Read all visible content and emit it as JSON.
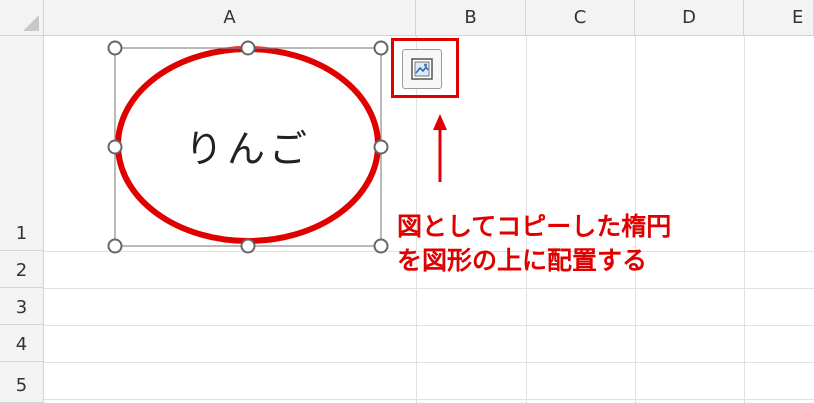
{
  "spreadsheet": {
    "columns": [
      "A",
      "B",
      "C",
      "D",
      "E"
    ],
    "rows": [
      "1",
      "2",
      "3",
      "4",
      "5"
    ]
  },
  "shape": {
    "text": "りんご",
    "outline_color": "#e00000",
    "selection_handle_icon": "resize-handle-icon"
  },
  "paste_options": {
    "icon": "paste-options-icon",
    "highlight_color": "#e00000"
  },
  "annotation": {
    "line1": "図としてコピーした楕円",
    "line2": "を図形の上に配置する",
    "color": "#e00000",
    "arrow_icon": "arrow-up-icon"
  }
}
